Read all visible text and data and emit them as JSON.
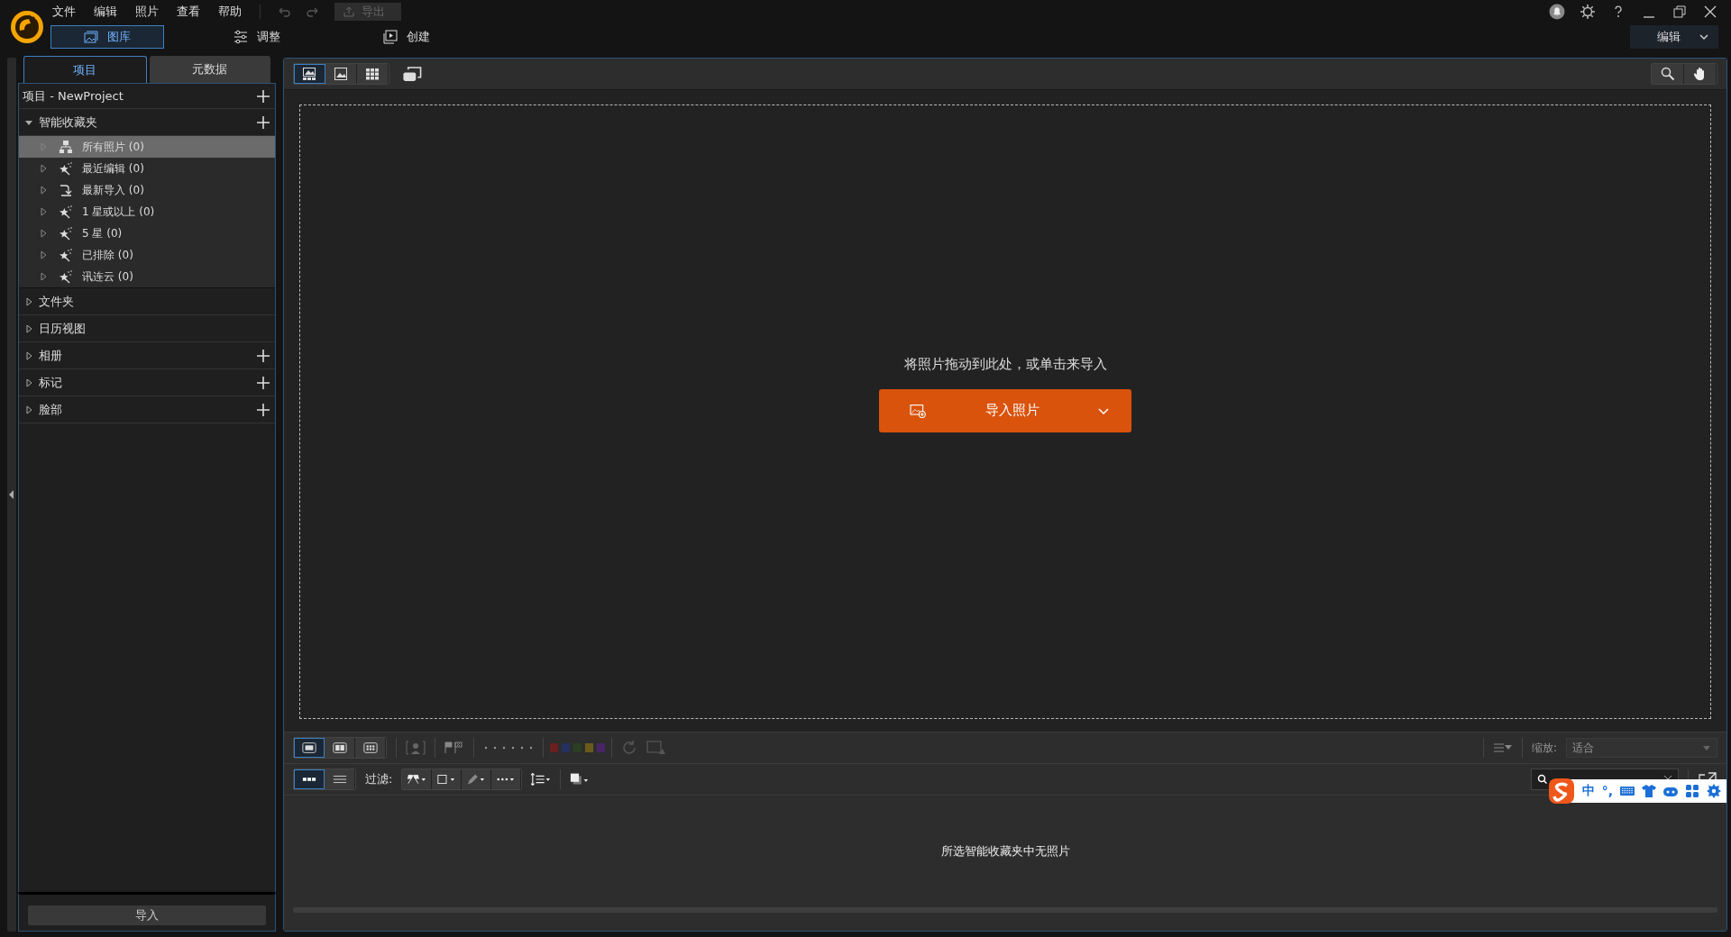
{
  "menu": [
    "文件",
    "编辑",
    "照片",
    "查看",
    "帮助"
  ],
  "export_button": {
    "label": "导出",
    "disabled": true
  },
  "modes": [
    {
      "label": "图库",
      "kind": "library",
      "selected": true
    },
    {
      "label": "调整",
      "kind": "adjust",
      "selected": false
    },
    {
      "label": "创建",
      "kind": "create",
      "selected": false
    }
  ],
  "workspace_dropdown": "编辑",
  "panel_tabs": [
    {
      "label": "项目",
      "selected": true
    },
    {
      "label": "元数据",
      "selected": false
    }
  ],
  "project_label": "项目 - NewProject",
  "sections": [
    {
      "label": "智能收藏夹",
      "expanded": true,
      "addable": true,
      "children": [
        {
          "label": "所有照片 (0)",
          "kind": "all",
          "selected": true
        },
        {
          "label": "最近编辑 (0)",
          "kind": "smart",
          "selected": false
        },
        {
          "label": "最新导入 (0)",
          "kind": "imported",
          "selected": false
        },
        {
          "label": "1 星或以上 (0)",
          "kind": "smart",
          "selected": false
        },
        {
          "label": "5 星 (0)",
          "kind": "smart",
          "selected": false
        },
        {
          "label": "已排除 (0)",
          "kind": "smart",
          "selected": false
        },
        {
          "label": "讯连云 (0)",
          "kind": "smart",
          "selected": false
        }
      ]
    },
    {
      "label": "文件夹",
      "expanded": false,
      "addable": false
    },
    {
      "label": "日历视图",
      "expanded": false,
      "addable": false
    },
    {
      "label": "相册",
      "expanded": false,
      "addable": true
    },
    {
      "label": "标记",
      "expanded": false,
      "addable": true
    },
    {
      "label": "脸部",
      "expanded": false,
      "addable": true
    }
  ],
  "footer_button": "导入",
  "view_buttons": [
    {
      "kind": "browser",
      "selected": true
    },
    {
      "kind": "viewer",
      "selected": false
    },
    {
      "kind": "grid",
      "selected": false
    }
  ],
  "drop_hint": "将照片拖动到此处，或单击来导入",
  "import_button": "导入照片",
  "layout_buttons": [
    {
      "kind": "single",
      "selected": true
    },
    {
      "kind": "dual",
      "selected": false
    },
    {
      "kind": "multi",
      "selected": false
    }
  ],
  "color_labels": [
    {
      "color": "#6b1f1f"
    },
    {
      "color": "#24305e"
    },
    {
      "color": "#2a3f22"
    },
    {
      "color": "#6b5a1e"
    },
    {
      "color": "#4a2566"
    }
  ],
  "zoom_label": "缩放:",
  "zoom_value": "适合",
  "strip_modes": [
    {
      "kind": "thumbs",
      "selected": true
    },
    {
      "kind": "list",
      "selected": false
    }
  ],
  "filter_label": "过滤:",
  "empty_message": "所选智能收藏夹中无照片",
  "ime": {
    "mode": "中",
    "punct": "°,"
  }
}
